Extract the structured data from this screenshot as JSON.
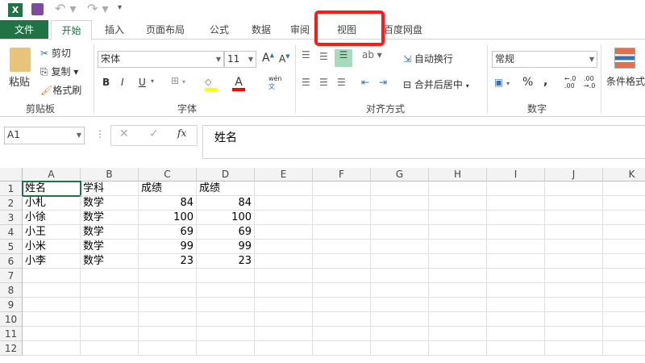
{
  "qat": {
    "icons": [
      "excel-logo-icon",
      "save-icon",
      "undo-icon",
      "redo-icon",
      "customize-icon"
    ]
  },
  "tabs": [
    "文件",
    "开始",
    "插入",
    "页面布局",
    "公式",
    "数据",
    "审阅",
    "视图",
    "百度网盘"
  ],
  "clipboard": {
    "paste": "粘贴",
    "cut": "剪切",
    "copy": "复制",
    "format_painter": "格式刷",
    "group": "剪贴板"
  },
  "font": {
    "name": "宋体",
    "size": "11",
    "group": "字体",
    "bold": "B",
    "italic": "I",
    "underline": "U",
    "font_color": "A",
    "phonetic": "wén"
  },
  "alignment": {
    "wrap": "自动换行",
    "merge": "合并后居中",
    "group": "对齐方式"
  },
  "number": {
    "format": "常规",
    "percent": "%",
    "comma": ",",
    "group": "数字"
  },
  "styles": {
    "conditional": "条件格式"
  },
  "formula_bar": {
    "name_box": "A1",
    "fx": "fx",
    "value": "姓名"
  },
  "columns": [
    "A",
    "B",
    "C",
    "D",
    "E",
    "F",
    "G",
    "H",
    "I",
    "J",
    "K"
  ],
  "rows": [
    "1",
    "2",
    "3",
    "4",
    "5",
    "6",
    "7",
    "8",
    "9",
    "10",
    "11",
    "12"
  ],
  "cells": [
    [
      "姓名",
      "学科",
      "成绩",
      "成绩"
    ],
    [
      "小札",
      "数学",
      "84",
      "84"
    ],
    [
      "小徐",
      "数学",
      "100",
      "100"
    ],
    [
      "小王",
      "数学",
      "69",
      "69"
    ],
    [
      "小米",
      "数学",
      "99",
      "99"
    ],
    [
      "小李",
      "数学",
      "23",
      "23"
    ]
  ],
  "colors": {
    "accent": "#217346",
    "highlight": "#ff1a1a"
  }
}
